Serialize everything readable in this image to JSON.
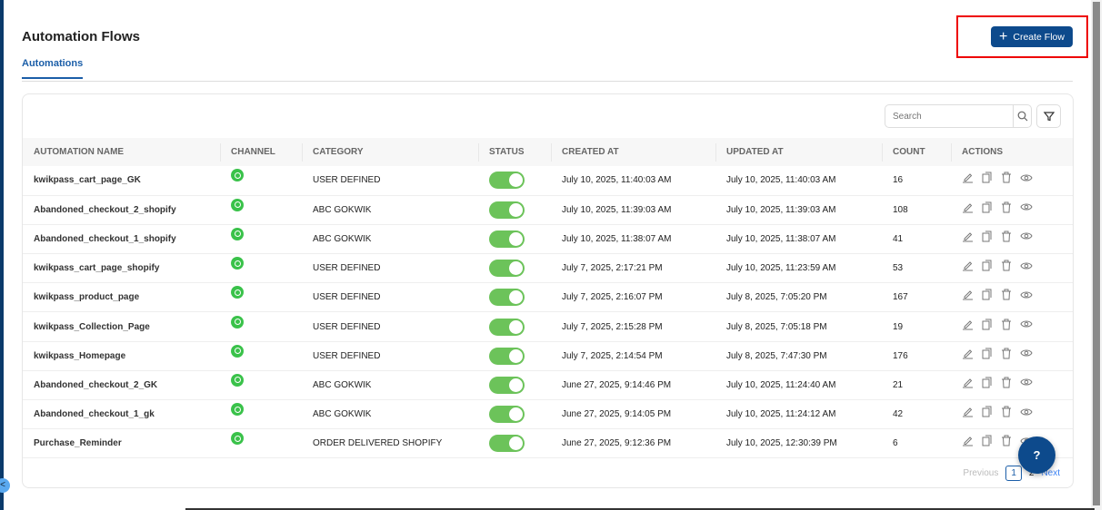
{
  "header": {
    "title": "Automation Flows",
    "create_label": "Create Flow",
    "tab": "Automations"
  },
  "toolbar": {
    "search_placeholder": "Search"
  },
  "table": {
    "columns": [
      "AUTOMATION NAME",
      "CHANNEL",
      "CATEGORY",
      "STATUS",
      "CREATED AT",
      "UPDATED AT",
      "COUNT",
      "ACTIONS"
    ],
    "rows": [
      {
        "name": "kwikpass_cart_page_GK",
        "channel": "whatsapp",
        "category": "USER DEFINED",
        "status": true,
        "created": "July 10, 2025, 11:40:03 AM",
        "updated": "July 10, 2025, 11:40:03 AM",
        "count": "16"
      },
      {
        "name": "Abandoned_checkout_2_shopify",
        "channel": "whatsapp",
        "category": "ABC GOKWIK",
        "status": true,
        "created": "July 10, 2025, 11:39:03 AM",
        "updated": "July 10, 2025, 11:39:03 AM",
        "count": "108"
      },
      {
        "name": "Abandoned_checkout_1_shopify",
        "channel": "whatsapp",
        "category": "ABC GOKWIK",
        "status": true,
        "created": "July 10, 2025, 11:38:07 AM",
        "updated": "July 10, 2025, 11:38:07 AM",
        "count": "41"
      },
      {
        "name": "kwikpass_cart_page_shopify",
        "channel": "whatsapp",
        "category": "USER DEFINED",
        "status": true,
        "created": "July 7, 2025, 2:17:21 PM",
        "updated": "July 10, 2025, 11:23:59 AM",
        "count": "53"
      },
      {
        "name": "kwikpass_product_page",
        "channel": "whatsapp",
        "category": "USER DEFINED",
        "status": true,
        "created": "July 7, 2025, 2:16:07 PM",
        "updated": "July 8, 2025, 7:05:20 PM",
        "count": "167"
      },
      {
        "name": "kwikpass_Collection_Page",
        "channel": "whatsapp",
        "category": "USER DEFINED",
        "status": true,
        "created": "July 7, 2025, 2:15:28 PM",
        "updated": "July 8, 2025, 7:05:18 PM",
        "count": "19"
      },
      {
        "name": "kwikpass_Homepage",
        "channel": "whatsapp",
        "category": "USER DEFINED",
        "status": true,
        "created": "July 7, 2025, 2:14:54 PM",
        "updated": "July 8, 2025, 7:47:30 PM",
        "count": "176"
      },
      {
        "name": "Abandoned_checkout_2_GK",
        "channel": "whatsapp",
        "category": "ABC GOKWIK",
        "status": true,
        "created": "June 27, 2025, 9:14:46 PM",
        "updated": "July 10, 2025, 11:24:40 AM",
        "count": "21"
      },
      {
        "name": "Abandoned_checkout_1_gk",
        "channel": "whatsapp",
        "category": "ABC GOKWIK",
        "status": true,
        "created": "June 27, 2025, 9:14:05 PM",
        "updated": "July 10, 2025, 11:24:12 AM",
        "count": "42"
      },
      {
        "name": "Purchase_Reminder",
        "channel": "whatsapp",
        "category": "ORDER DELIVERED SHOPIFY",
        "status": true,
        "created": "June 27, 2025, 9:12:36 PM",
        "updated": "July 10, 2025, 12:30:39 PM",
        "count": "6"
      }
    ]
  },
  "pagination": {
    "previous": "Previous",
    "pages": [
      "1",
      "2"
    ],
    "current": "1",
    "next": "Next"
  },
  "colors": {
    "primary": "#0d4a8c",
    "toggle_on": "#6cc35a",
    "whatsapp": "#3ac24a",
    "highlight": "#e00000"
  }
}
